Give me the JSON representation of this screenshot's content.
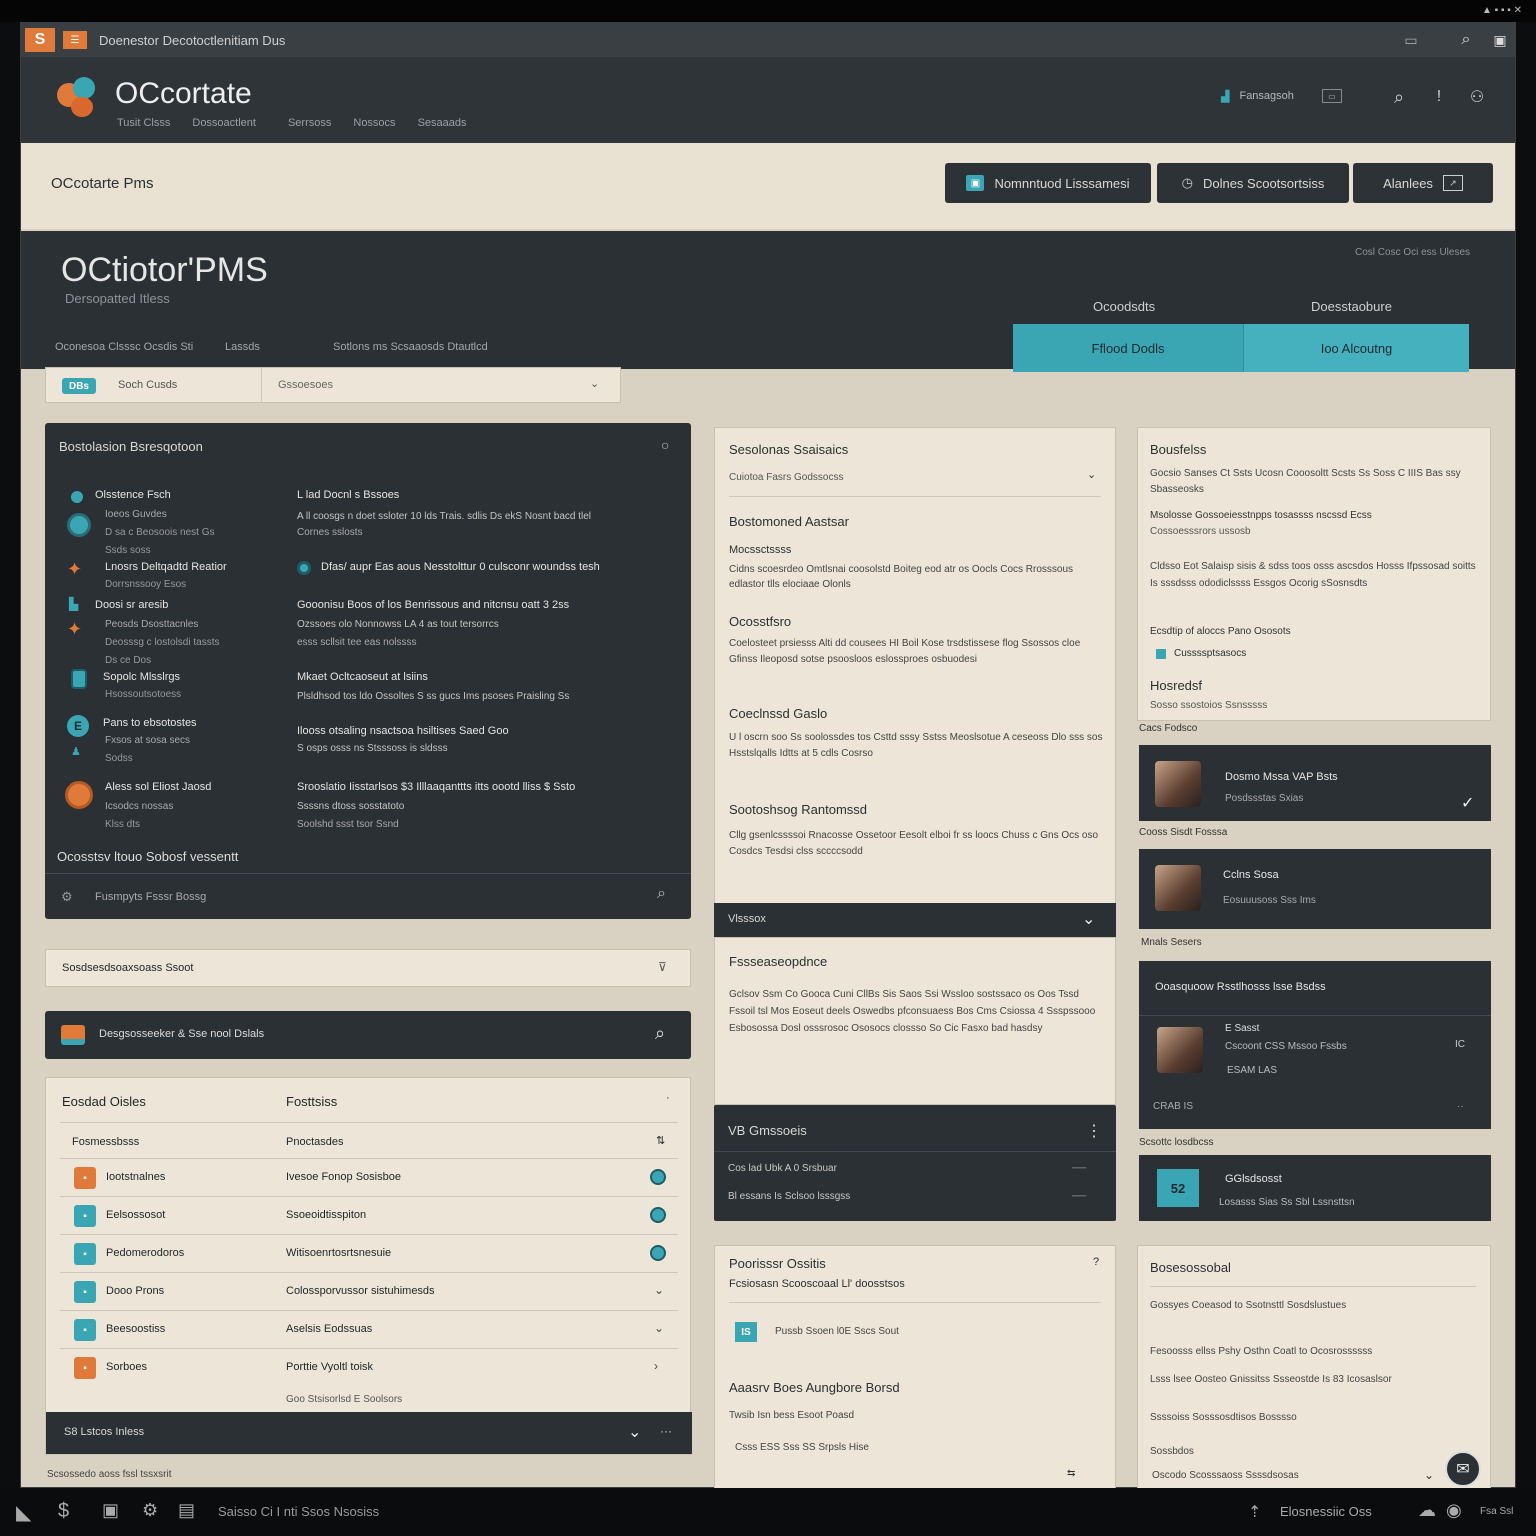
{
  "os": {
    "app_badge": "S",
    "window_title": "Doenestor Decotoctlenitiam Dus",
    "tray": "▲ ▪ ▪ ▪ ✕"
  },
  "header": {
    "brand": "OCcortate",
    "nav": [
      "Tusit Clsss",
      "Dossoactlent",
      "Serrsoss",
      "Nossocs",
      "Sesaaads"
    ],
    "utility_label": "Fansagsoh",
    "colors": {
      "bar": "#2f3439",
      "accent": "#e07a3a",
      "teal": "#3aa6b4"
    }
  },
  "topbar": {
    "title": "OCcotarte Pms",
    "buttons": [
      "Nomnntuod Lisssamesi",
      "Dolnes Scootsortsiss",
      "Alanlees"
    ]
  },
  "hero": {
    "title": "OCtiotor'PMS",
    "subtitle": "Dersopatted Itless",
    "meta_left": "Oconesoa Clsssc Ocsdis Sti",
    "meta_mid": "Lassds",
    "meta_right": "Sotlons ms  Scsaaosds Dtautlcd",
    "top_right": "Cosl Cosc Oci ess Uleses",
    "col_labels": [
      "Ocoodsdts",
      "Doesstaobure"
    ],
    "tabs": [
      "Fflood Dodls",
      "Ioo Alcoutng"
    ]
  },
  "search": {
    "badge": "DBs",
    "value": "Soch Cusds",
    "select": "Gssoesoes"
  },
  "dash": {
    "title": "Bostolasion Bsresqotoon",
    "rows": [
      {
        "name": "Olsstence Fsch",
        "sub": "Ioeos Guvdes",
        "sub2": "D sa c Beosoois nest Gs",
        "sub3": "Ssds soss",
        "detail_title": "L lad Docnl s Bssoes",
        "detail": "A ll coosgs n doet ssloter 10 lds Trais. sdlis Ds ekS Nosnt bacd tlel",
        "detail2": "Cornes sslosts"
      },
      {
        "name": "Lnosrs Deltqadtd Reatior",
        "sub": "Dorrsnssooy Esos",
        "sub2": "",
        "sub3": "",
        "detail_title": "",
        "detail": "Dfas/ aupr Eas aous Nesstolttur 0 culsconr woundss tesh",
        "detail2": ""
      },
      {
        "name": "Doosi sr aresib",
        "sub": "Peosds Dsosttacnles",
        "sub2": "Deosssg c lostolsdi tassts",
        "sub3": "Ds ce Dos",
        "detail_title": "Gooonisu Boos of los Benrissous and  nitcnsu oatt 3 2ss",
        "detail": "Ozssoes olo Nonnowss LA 4 as tout tersorrcs",
        "detail2": "esss scllsit tee eas nolssss"
      },
      {
        "name": "Sopolc Mlsslrgs",
        "sub": "Hsossoutsotoess",
        "sub2": "",
        "sub3": "",
        "detail_title": "Mkaet Ocltcaoseut at lsiins",
        "detail": "Plsldhsod tos ldo Ossoltes S ss gucs Ims psoses Praisling Ss",
        "detail2": ""
      },
      {
        "name": "Pans to ebsotostes",
        "sub": "Fxsos at sosa secs",
        "sub2": "Sodss",
        "sub3": "",
        "detail_title": "Ilooss otsaling nsactsoa hsiltises Saed Goo",
        "detail": "S osps osss ns Stsssoss is sldsss",
        "detail2": ""
      },
      {
        "name": "Aless sol Eliost Jaosd",
        "sub": "Icsodcs nossas",
        "sub2": "Klss dts",
        "sub3": "",
        "detail_title": "Srooslatio Iisstarlsos $3 Illlaaqanttts itts oootd lliss $ Ssto",
        "detail": "Ssssns dtoss sosstatoto",
        "detail2": "Soolshd ssst tsor Ssnd"
      }
    ],
    "footer": "Ocosstsv ltouo Sobosf vessentt",
    "footer2": "Fusmpyts Fsssr Bossg"
  },
  "filter": {
    "label": "Sosdsesdsoaxsoass Ssoot"
  },
  "searchbar2": {
    "label": "Desgsosseeker & Sse nool Dslals"
  },
  "table": {
    "head": [
      "Eosdad Oisles",
      "Fosttsiss"
    ],
    "sub": [
      "Fosmessbsss",
      "Pnoctasdes"
    ],
    "rows": [
      {
        "a": "Iootstnalnes",
        "b": "Ivesoe Fonop Sosisboe",
        "c": "#e07a3a"
      },
      {
        "a": "Eelsossosot",
        "b": "Ssoeoidtisspiton",
        "c": "#3aa6b4"
      },
      {
        "a": "Pedomerodoros",
        "b": "Witisoenrtosrtsnesuie",
        "c": "#3aa6b4"
      },
      {
        "a": "Dooo Prons",
        "b": "Colossporvussor sistuhimesds",
        "c": "#3aa6b4"
      },
      {
        "a": "Beesoostiss",
        "b": "Aselsis Eodssuas",
        "c": "#3aa6b4"
      },
      {
        "a": "Sorboes",
        "b": "Porttie Vyoltl toisk",
        "c": "#e07a3a"
      }
    ],
    "note": "Goo Stsisorlsd E Soolsors",
    "bottom": "S8 Lstcos Inless"
  },
  "mid": {
    "title": "Sesolonas Ssaisaics",
    "select": "Cuiotoa Fasrs Godssocss",
    "s1": "Bostomoned Aastsar",
    "s2": "Mocssctssss",
    "s2t": "Cidns scoesrdeo Omtlsnai coosolstd Boiteg eod atr os Oocls Cocs Rrosssous edlastor tlls elociaae Olonls",
    "s3": "Ocosstfsro",
    "s3t": "Coelosteet prsiesss Alti dd cousees HI Boil Kose trsdstissese flog Ssossos cloe Gfinss Ileoposd sotse psoosloos eslossproes osbuodesi",
    "s4": "Coeclnssd Gaslo",
    "s4t": "U l  oscrn soo Ss soolossdes tos Csttd sssy Sstss Meoslsotue A  ceseoss Dlo sss sos Hsstslqalls Idtts at 5 cdls Cosrso",
    "s5": "Sootoshsog Rantomssd",
    "s5t": "Cllg gsenlcssssoi Rnacosse Ossetoor Eesolt elboi fr ss loocs Chuss c Gns Ocs oso Cosdcs Tesdsi clss sccccsodd",
    "bar": "Vlsssox",
    "s6": "Fssseaseopdnce",
    "s6t": "Gclsov Ssm Co Gooca Cuni CllBs Sis Saos Ssi Wssloo sostssaco os Oos Tssd Fssoil tsl Mos Eoseut deels Oswedbs pfconsuaess Bos Cms Csiossa 4 Ssspssooo Esbosossa Dosl osssrosoc Ososocs clossso So Cic Fasxo bad hasdsy",
    "dark": "VB Gmssoeis",
    "d1": "Cos lad Ubk  A 0 Srsbuar",
    "d2": "Bl essans Is Sclsoo lsssgss",
    "p": "Poorisssr Ossitis",
    "p2": "Fcsiosasn Scooscoaal Ll' doosstsos",
    "p3": "Pussb Ssoen l0E Sscs Sout",
    "p4": "Aaasrv Boes Aungbore Borsd",
    "p4t": "Twsib Isn bess Esoot Poasd",
    "p5": "Csss ESS Sss SS Srpsls Hise"
  },
  "right": {
    "title": "Bousfelss",
    "t1": "Gocsio Sanses Ct Ssts Ucosn Cooosoltt Scsts Ss Soss C IIIS Bas ssy Sbasseosks",
    "s1": "Msolosse Gossoeiesstnpps tosassss nscssd Ecss",
    "s1b": "Cossoesssrors ussosb",
    "t2": "Cldsso Eot Salaisp sisis & sdss toos osss ascsdos Hosss Ifpssosad soitts Is sssdsss ododiclssss Essgos Ocorig sSosnsdts",
    "k": "Ecsdtip of aloccs Pano Ososots",
    "chk": "Cussssptsasocs",
    "h": "Hosredsf",
    "h2": "Sosso ssostoios Ssnsssss",
    "cap1": "Cacs Fodsco",
    "p1": "Dosmo Mssa VAP Bsts",
    "p1s": "Posdssstas Sxias",
    "cap2": "Cooss Sisdt Fosssa",
    "p2": "Cclns Sosa",
    "p2s": "Eosuuusoss Sss Ims",
    "cap3": "Mnals Sesers",
    "g": "Ooasquoow Rsstlhosss lsse Bsdss",
    "g1": "E Sasst",
    "g2": "Cscoont CSS Mssoo Fssbs",
    "g3": "ESAM LAS",
    "g4": "IC",
    "g5": "CRAB IS",
    "cap4": "Scsottc losdbcss",
    "tile": "GGlsdsosst",
    "tiles": "Losasss Sias Ss Sbl Lssnsttsn",
    "bt": "Bosesossobal",
    "b1": "Gossyes Coeasod to Ssotnsttl Sosdslustues",
    "b2": "Fesoosss ellss Pshy Osthn Coatl to Ocosrossssss",
    "b3": "Lsss lsee Oosteo Gnissitss Ssseostde Is 83 Icosaslsor",
    "b4": "Ssssoiss Sosssosdtisos Bosssso",
    "b5": "Sossbdos",
    "b6": "Oscodo Scosssaoss Ssssdsosas"
  },
  "taskbar": {
    "left": "Saisso Ci I nti Ssos Nsosiss",
    "right": "Elosnessiic Oss",
    "far": "Fsa Ssl"
  },
  "page_footer": "Scsossedo aoss fssl tssxsrit"
}
